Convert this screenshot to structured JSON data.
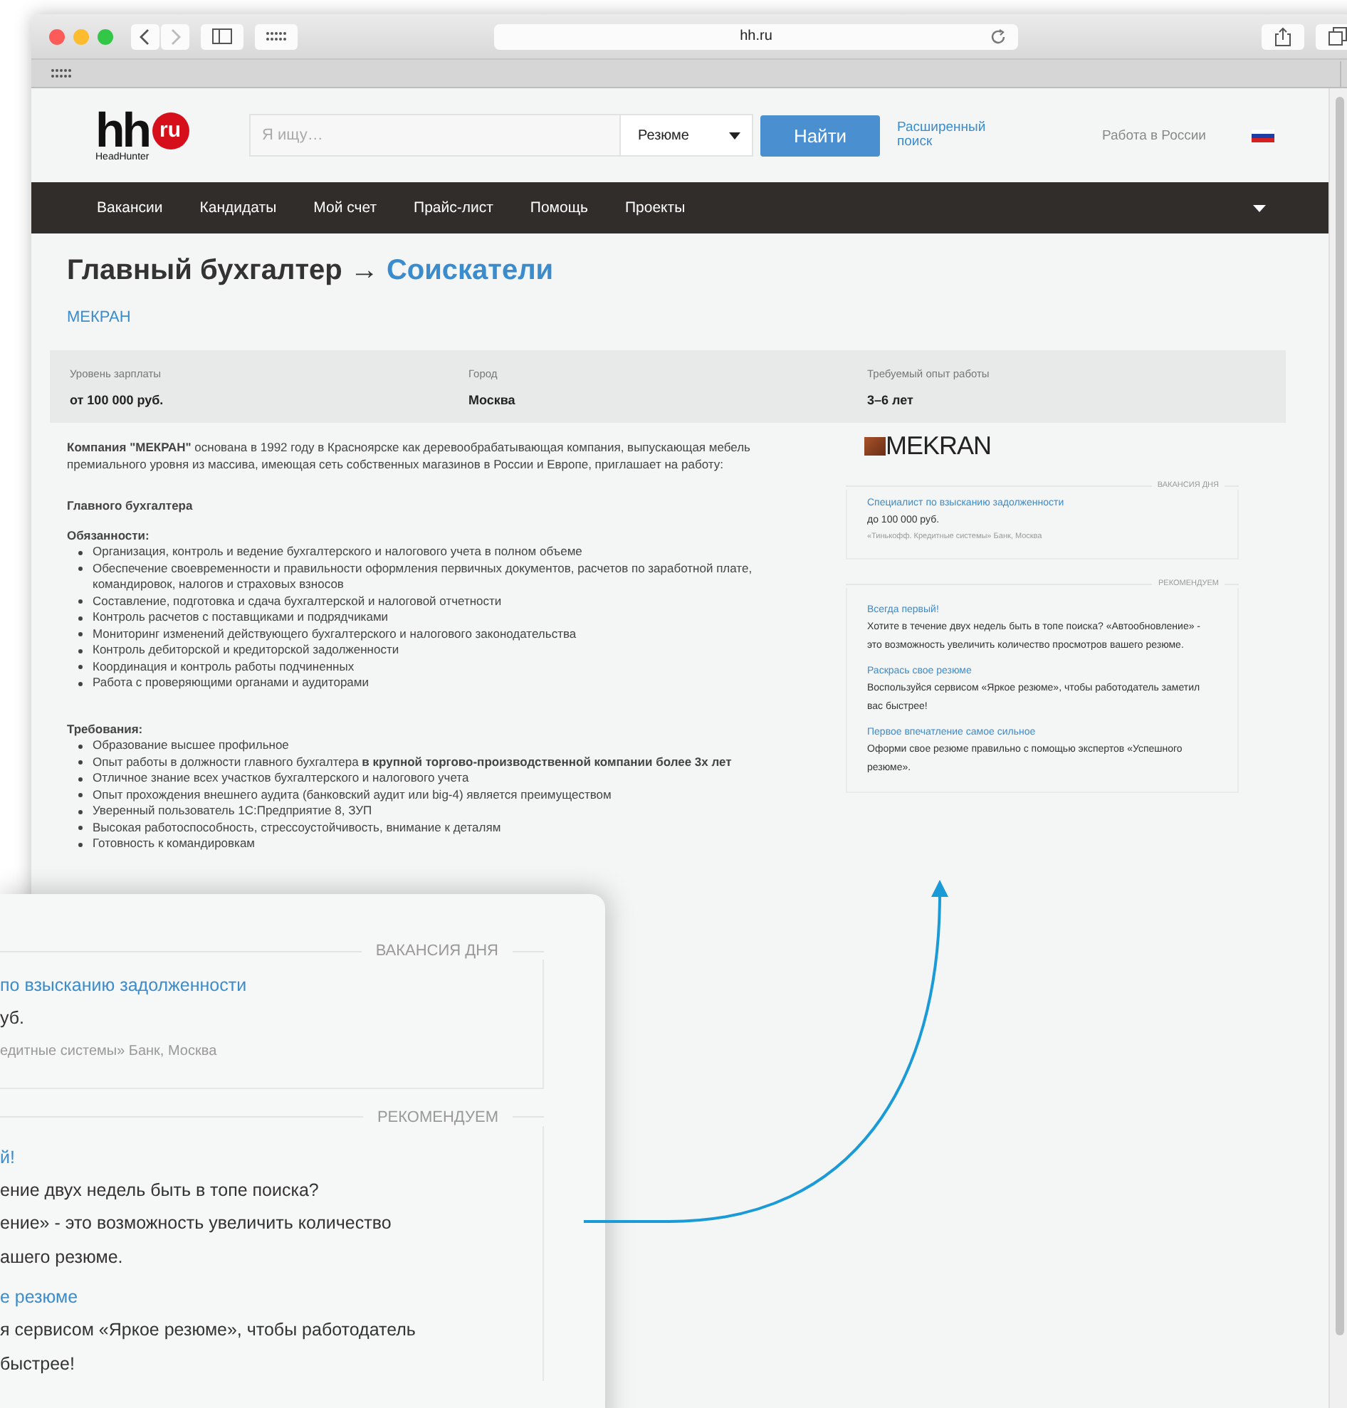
{
  "browser": {
    "address": "hh.ru"
  },
  "header": {
    "logo_text": "hh",
    "logo_badge": "ru",
    "logo_caption": "HeadHunter",
    "search": {
      "placeholder": "Я ищу…"
    },
    "search_type": "Резюме",
    "search_button": "Найти",
    "advanced_search": "Расширенный поиск",
    "region": "Работа в России"
  },
  "nav": [
    "Вакансии",
    "Кандидаты",
    "Мой счет",
    "Прайс-лист",
    "Помощь",
    "Проекты"
  ],
  "title": {
    "text": "Главный бухгалтер",
    "arrow": "→",
    "link": "Соискатели"
  },
  "company": "МЕКРАН",
  "facts": [
    {
      "label": "Уровень зарплаты",
      "value": "от 100 000 руб."
    },
    {
      "label": "Город",
      "value": "Москва"
    },
    {
      "label": "Требуемый опыт работы",
      "value": "3–6 лет"
    }
  ],
  "description": {
    "intro": "**Компания \"МЕКРАН\"** основана в 1992 году в Красноярске как деревообрабатывающая компания, выпускающая мебель премиального уровня из массива, имеющая сеть собственных магазинов в России и Европе, приглашает на работу:",
    "position": "Главного бухгалтера",
    "sections": [
      {
        "heading": "Обязанности:",
        "items": [
          "Организация, контроль и ведение бухгалтерского и налогового учета в полном объеме",
          "Обеспечение своевременности и правильности оформления первичных документов, расчетов по заработной плате, командировок, налогов и страховых взносов",
          "Составление, подготовка и сдача бухгалтерской и налоговой отчетности",
          "Контроль расчетов с поставщиками и подрядчиками",
          "Мониторинг изменений действующего бухгалтерского и налогового законодательства",
          "Контроль дебиторской и кредиторской задолженности",
          "Координация и контроль работы подчиненных",
          "Работа с проверяющими органами и аудиторами"
        ]
      },
      {
        "heading": "Требования:",
        "items": [
          "Образование высшее профильное",
          "Опыт работы в должности главного бухгалтера **в крупной торгово-производственной компании более 3х лет**",
          "Отличное знание всех участков бухгалтерского и налогового учета",
          "Опыт прохождения внешнего аудита (банковский аудит или big-4) является преимуществом",
          "Уверенный пользователь 1С:Предприятие 8, ЗУП",
          "Высокая работоспособность, стрессоустойчивость, внимание к деталям",
          "Готовность к командировкам"
        ]
      }
    ]
  },
  "sidebar": {
    "logo": "MEKRAN",
    "vacancy": {
      "heading": "ВАКАНСИЯ ДНЯ",
      "title": "Специалист по взысканию задолженности",
      "salary": "до 100 000 руб.",
      "company": "«Тинькофф. Кредитные системы» Банк, Москва"
    },
    "recommend": {
      "heading": "РЕКОМЕНДУЕМ",
      "items": [
        {
          "title": "Всегда первый!",
          "text": "Хотите в течение двух недель быть в топе поиска? «Автообновление» - это возможность увеличить количество просмотров вашего резюме."
        },
        {
          "title": "Раскрась свое резюме",
          "text": "Воспользуйся сервисом «Яркое резюме», чтобы работодатель заметил вас быстрее!"
        },
        {
          "title": "Первое впечатление самое сильное",
          "text": "Оформи свое резюме правильно с помощью экспертов «Успешного резюме»."
        }
      ]
    }
  },
  "callout": {
    "vacancy": {
      "heading": "ВАКАНСИЯ ДНЯ",
      "title": "по взысканию задолженности",
      "salary": "уб.",
      "company": "едитные системы» Банк, Москва"
    },
    "recommend": {
      "heading": "РЕКОМЕНДУЕМ",
      "items": [
        {
          "title": "й!",
          "lines": [
            "ение двух недель быть в топе поиска?",
            "ение» - это возможность увеличить количество",
            "ашего резюме."
          ]
        },
        {
          "title": "е резюме",
          "lines": [
            "я сервисом «Яркое резюме», чтобы работодатель",
            "быстрее!"
          ]
        }
      ]
    }
  }
}
